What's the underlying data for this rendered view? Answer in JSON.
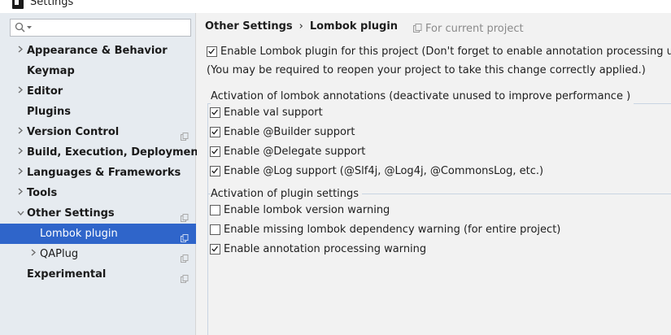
{
  "window": {
    "title": "Settings"
  },
  "search": {
    "placeholder": "",
    "value": ""
  },
  "sidebar": {
    "items": [
      {
        "label": "Appearance & Behavior",
        "arrow": "right",
        "copy": false
      },
      {
        "label": "Keymap",
        "arrow": "none",
        "copy": false
      },
      {
        "label": "Editor",
        "arrow": "right",
        "copy": false
      },
      {
        "label": "Plugins",
        "arrow": "none",
        "copy": false
      },
      {
        "label": "Version Control",
        "arrow": "right",
        "copy": true
      },
      {
        "label": "Build, Execution, Deployment",
        "arrow": "right",
        "copy": false
      },
      {
        "label": "Languages & Frameworks",
        "arrow": "right",
        "copy": false
      },
      {
        "label": "Tools",
        "arrow": "right",
        "copy": false
      },
      {
        "label": "Other Settings",
        "arrow": "down",
        "copy": true
      },
      {
        "label": "Lombok plugin",
        "arrow": "none",
        "copy": true,
        "child": true,
        "selected": true
      },
      {
        "label": "QAPlug",
        "arrow": "right",
        "copy": true,
        "child": true
      },
      {
        "label": "Experimental",
        "arrow": "none",
        "copy": true
      }
    ]
  },
  "breadcrumb": {
    "parent": "Other Settings",
    "separator": "›",
    "current": "Lombok plugin"
  },
  "scope": {
    "label": "For current project"
  },
  "main": {
    "enable_plugin": {
      "label": "Enable Lombok plugin for this project (Don't forget to enable annotation processing under Cor",
      "checked": true
    },
    "note": "(You may be required to reopen your project to take this change correctly applied.)",
    "group_annotations": {
      "title": "Activation of lombok annotations (deactivate unused to improve performance )",
      "items": [
        {
          "label": "Enable val support",
          "checked": true
        },
        {
          "label": "Enable @Builder support",
          "checked": true
        },
        {
          "label": "Enable @Delegate support",
          "checked": true
        },
        {
          "label": "Enable @Log support (@Slf4j, @Log4j, @CommonsLog, etc.)",
          "checked": true
        }
      ]
    },
    "group_plugin": {
      "title": "Activation of plugin settings",
      "items": [
        {
          "label": "Enable lombok version warning",
          "checked": false
        },
        {
          "label": "Enable missing lombok dependency warning (for entire project)",
          "checked": false
        },
        {
          "label": "Enable annotation processing warning",
          "checked": true
        }
      ]
    }
  },
  "colors": {
    "sidebar_bg": "#e6ebf0",
    "selected_bg": "#2f65ca",
    "selected_fg": "#ffffff",
    "content_bg": "#f2f2f2",
    "muted_text": "#8a8a8a"
  }
}
